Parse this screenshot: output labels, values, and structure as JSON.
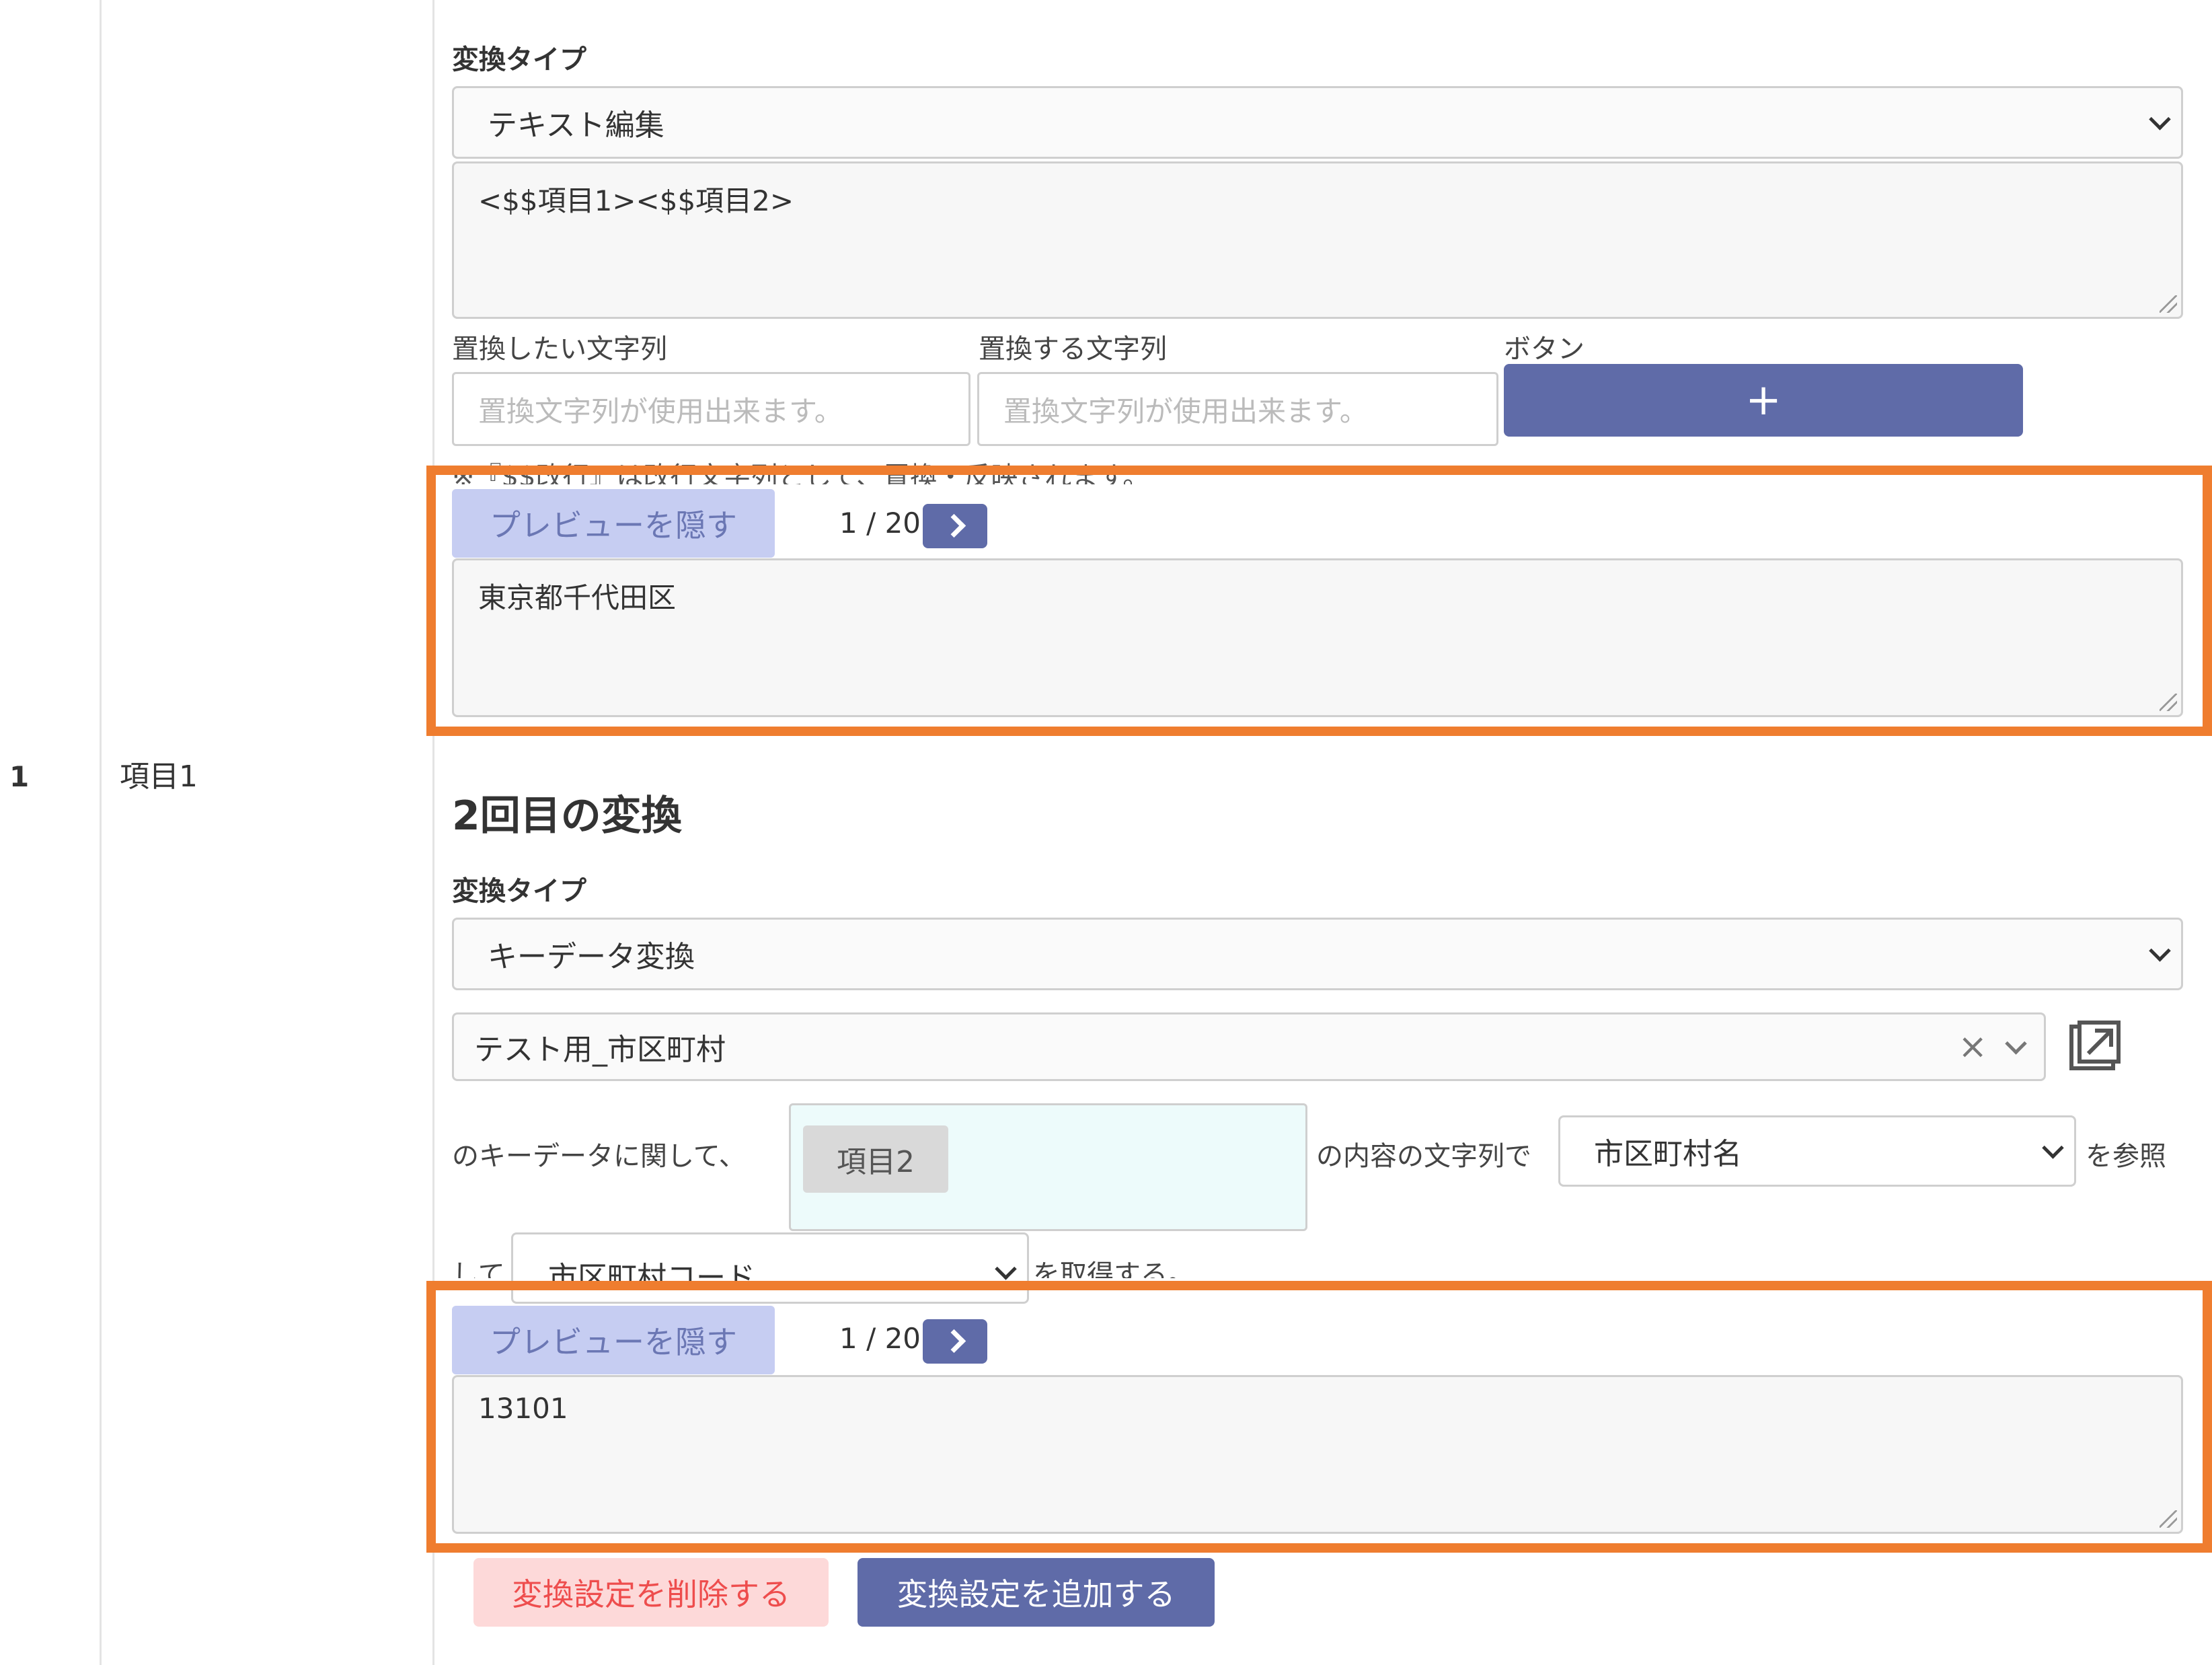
{
  "row": {
    "number": "1",
    "item_name": "項目1"
  },
  "first_conversion": {
    "type_label": "変換タイプ",
    "type_value": "テキスト編集",
    "template_text": "<$$項目1><$$項目2>",
    "replace_from_label": "置換したい文字列",
    "replace_to_label": "置換する文字列",
    "button_label": "ボタン",
    "replace_from_placeholder": "置換文字列が使用出来ます。",
    "replace_to_placeholder": "置換文字列が使用出来ます。",
    "add_button": "+",
    "note": "※『$$改行』は改行文字列として、置換・反映されます。",
    "preview_button": "プレビューを隠す",
    "pager": "1 / 20",
    "preview_value": "東京都千代田区"
  },
  "second_conversion": {
    "heading": "2回目の変換",
    "type_label": "変換タイプ",
    "type_value": "キーデータ変換",
    "keydata_value": "テスト用_市区町村",
    "clear_icon": "×",
    "phrase_keydata": "のキーデータに関して、",
    "tag": "項目2",
    "phrase_content": "の内容の文字列で",
    "ref_column": "市区町村名",
    "phrase_ref": "を参照",
    "phrase_shite": "して",
    "get_column": "市区町村コード",
    "phrase_get": "を取得する。",
    "preview_button": "プレビューを隠す",
    "pager": "1 / 20",
    "preview_value": "13101"
  },
  "actions": {
    "delete_label": "変換設定を削除する",
    "add_label": "変換設定を追加する"
  },
  "colors": {
    "highlight": "#ef7d2f",
    "primary": "#5f6ba8",
    "preview": "#c6cdf2",
    "delete_bg": "#fdd9d9",
    "delete_text": "#ee4d4d",
    "tag_area": "#edfbfb"
  }
}
